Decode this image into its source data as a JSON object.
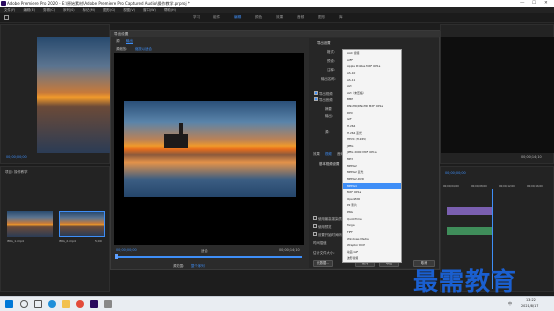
{
  "window": {
    "title": "Adobe Premiere Pro 2020 - E:\\原始素材\\Adobe Premiere Pro Captured Audio\\操作教学.prproj *",
    "minimize": "—",
    "maximize": "☐",
    "close": "✕"
  },
  "menu": [
    "文件(F)",
    "编辑(E)",
    "剪辑(C)",
    "序列(S)",
    "标记(M)",
    "图形(G)",
    "视图(V)",
    "窗口(W)",
    "帮助(H)"
  ],
  "workspaces": [
    "学习",
    "组件",
    "编辑",
    "颜色",
    "效果",
    "音频",
    "图形",
    "库"
  ],
  "export_dialog": {
    "title": "导出设置",
    "tabs": [
      "源",
      "输出"
    ],
    "source_scaling_label": "源缩放:",
    "source_scaling_value": "缩放以适合",
    "timecode_left": "00;00;00;00",
    "timecode_right": "00;00;14;10",
    "fit_label": "适合",
    "range_label": "源范围:",
    "range_value": "整个序列",
    "export_settings_header": "导出设置",
    "format_label": "格式:",
    "format_value": "MPEG4",
    "preset_label": "预设:",
    "comments_label": "注释:",
    "output_name_label": "输出名称:",
    "export_video_label": "导出视频",
    "export_audio_label": "导出音频",
    "summary_header": "摘要",
    "summary_output_label": "输出:",
    "summary_source_label": "源:",
    "tab_effects": "效果",
    "tab_video": "视频",
    "tab_audio": "音频",
    "basic_video_header": "基本视频设置",
    "checkbox_max_render": "使用最高渲染质量",
    "checkbox_previews": "使用预览",
    "checkbox_proxies": "设置开始时间码",
    "checkbox_interp": "时间插值",
    "file_size_label": "估计文件大小:",
    "metadata_button": "元数据...",
    "queue_button": "队列",
    "export_button": "导出",
    "cancel_button": "取消",
    "ok_button": "确定",
    "format_options": [
      "AAC 音频",
      "AIFF",
      "Apple ProRes MXF OP1a",
      "AS-10",
      "AS-11",
      "AVI",
      "AVI（未压缩）",
      "BMP",
      "DNxHR/DNxHD MXF OP1a",
      "DPX",
      "GIF",
      "H.264",
      "H.264 蓝光",
      "HEVC (H.265)",
      "JPEG",
      "JPEG 2000 MXF OP1a",
      "MP3",
      "MPEG2",
      "MPEG2 蓝光",
      "MPEG2-DVD",
      "MPEG4",
      "MXF OP1a",
      "OpenEXR",
      "P2 影片",
      "PNG",
      "QuickTime",
      "Targa",
      "TIFF",
      "Windows Media",
      "Wraptor DCP",
      "动画 GIF",
      "波形音频"
    ],
    "selected_format_index": 20
  },
  "left_panels": {
    "program_timecode": "00;00;00;00",
    "project_label": "项目: 操作教学",
    "clip1_name": "IMG_1.mp4",
    "clip2_name": "IMG_2.mp4",
    "clip2_duration": "5;00"
  },
  "right_panels": {
    "timecode_top": "00;00;14;10",
    "timeline_timecode": "00;00;00;00",
    "ruler": [
      "00;00",
      "00;00;04;00",
      "00;00;08;00",
      "00;00;12;00",
      "00;00;16;00"
    ]
  },
  "taskbar": {
    "time": "13:22",
    "date": "2021/8/17",
    "ime": "中"
  },
  "watermark": "最需教育"
}
